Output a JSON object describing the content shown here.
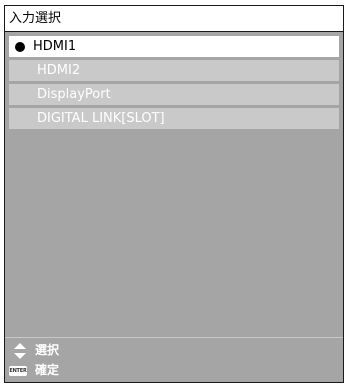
{
  "menu": {
    "title": "入力選択",
    "options": [
      {
        "label": "HDMI1",
        "selected": true
      },
      {
        "label": "HDMI2",
        "selected": false
      },
      {
        "label": "DisplayPort",
        "selected": false
      },
      {
        "label": "DIGITAL LINK[SLOT]",
        "selected": false
      }
    ]
  },
  "footer": {
    "select": {
      "icon": "up-down-arrow-icon",
      "label": "選択"
    },
    "confirm": {
      "icon": "enter-key-icon",
      "key_text": "ENTER",
      "label": "確定"
    }
  },
  "colors": {
    "panel_background": "#a5a5a5",
    "option_background": "#c9c9c9",
    "selected_background": "#ffffff",
    "border": "#1a1a1a"
  }
}
